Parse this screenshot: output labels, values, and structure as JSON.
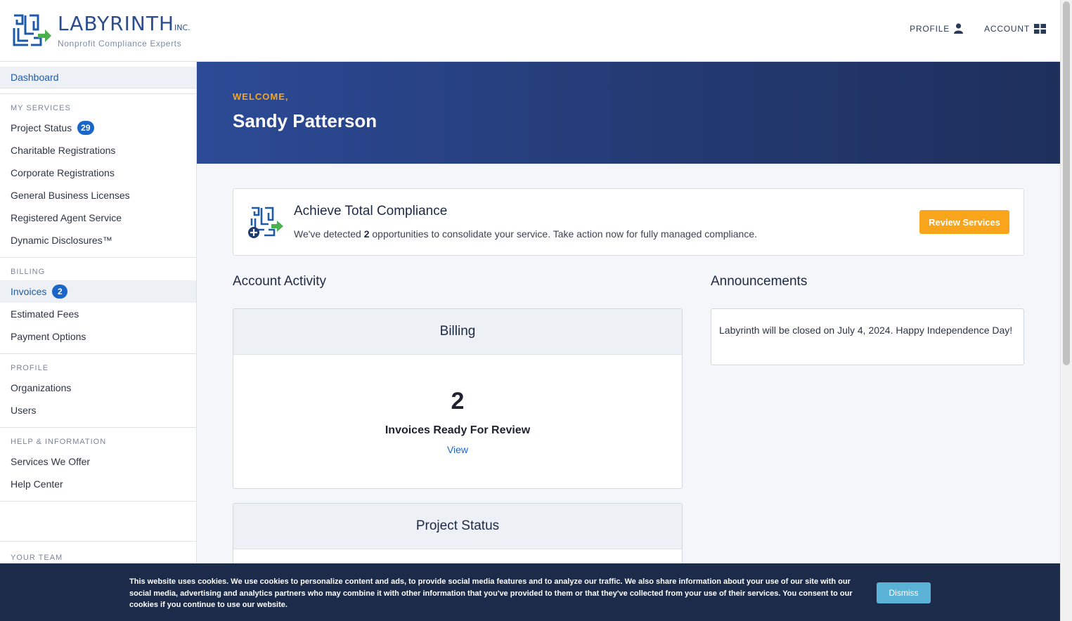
{
  "header": {
    "logo_name": "LABYRINTH",
    "logo_suffix": "INC.",
    "logo_tagline": "Nonprofit Compliance Experts",
    "nav": [
      {
        "label": "PROFILE",
        "icon": "person-icon"
      },
      {
        "label": "ACCOUNT",
        "icon": "grid-icon"
      }
    ]
  },
  "sidebar": {
    "dashboard": "Dashboard",
    "sections": [
      {
        "heading": "MY SERVICES",
        "items": [
          {
            "label": "Project Status",
            "badge": "29"
          },
          {
            "label": "Charitable Registrations"
          },
          {
            "label": "Corporate Registrations"
          },
          {
            "label": "General Business Licenses"
          },
          {
            "label": "Registered Agent Service"
          },
          {
            "label": "Dynamic Disclosures™"
          }
        ]
      },
      {
        "heading": "BILLING",
        "items": [
          {
            "label": "Invoices",
            "badge": "2",
            "active": true
          },
          {
            "label": "Estimated Fees"
          },
          {
            "label": "Payment Options"
          }
        ]
      },
      {
        "heading": "PROFILE",
        "items": [
          {
            "label": "Organizations"
          },
          {
            "label": "Users"
          }
        ]
      },
      {
        "heading": "HELP & INFORMATION",
        "items": [
          {
            "label": "Services We Offer"
          },
          {
            "label": "Help Center"
          }
        ]
      }
    ],
    "your_team": "YOUR TEAM"
  },
  "hero": {
    "welcome": "WELCOME,",
    "name": "Sandy Patterson"
  },
  "compliance": {
    "title": "Achieve Total Compliance",
    "text_before": "We've detected ",
    "count": "2",
    "text_after": " opportunities to consolidate your service. Take action now for fully managed compliance.",
    "button": "Review Services"
  },
  "activity": {
    "heading": "Account Activity",
    "billing": {
      "title": "Billing",
      "count": "2",
      "label": "Invoices Ready For Review",
      "link": "View"
    },
    "project_status": {
      "title": "Project Status"
    }
  },
  "announcements": {
    "heading": "Announcements",
    "items": [
      "Labyrinth will be closed on July 4, 2024. Happy Independence Day!"
    ]
  },
  "cookie": {
    "text": "This website uses cookies. We use cookies to personalize content and ads, to provide social media features and to analyze our traffic. We also share information about your use of our site with our social media, advertising and analytics partners who may combine it with other information that you've provided to them or that they've collected from your use of their services. You consent to our cookies if you continue to use our website.",
    "button": "Dismiss"
  },
  "colors": {
    "primary": "#2a4d8f",
    "accent": "#f8a51b",
    "badge": "#1a66c9",
    "link": "#1a66c9",
    "cookie_bg": "#1c2b4a",
    "dismiss": "#5ab2d6"
  }
}
